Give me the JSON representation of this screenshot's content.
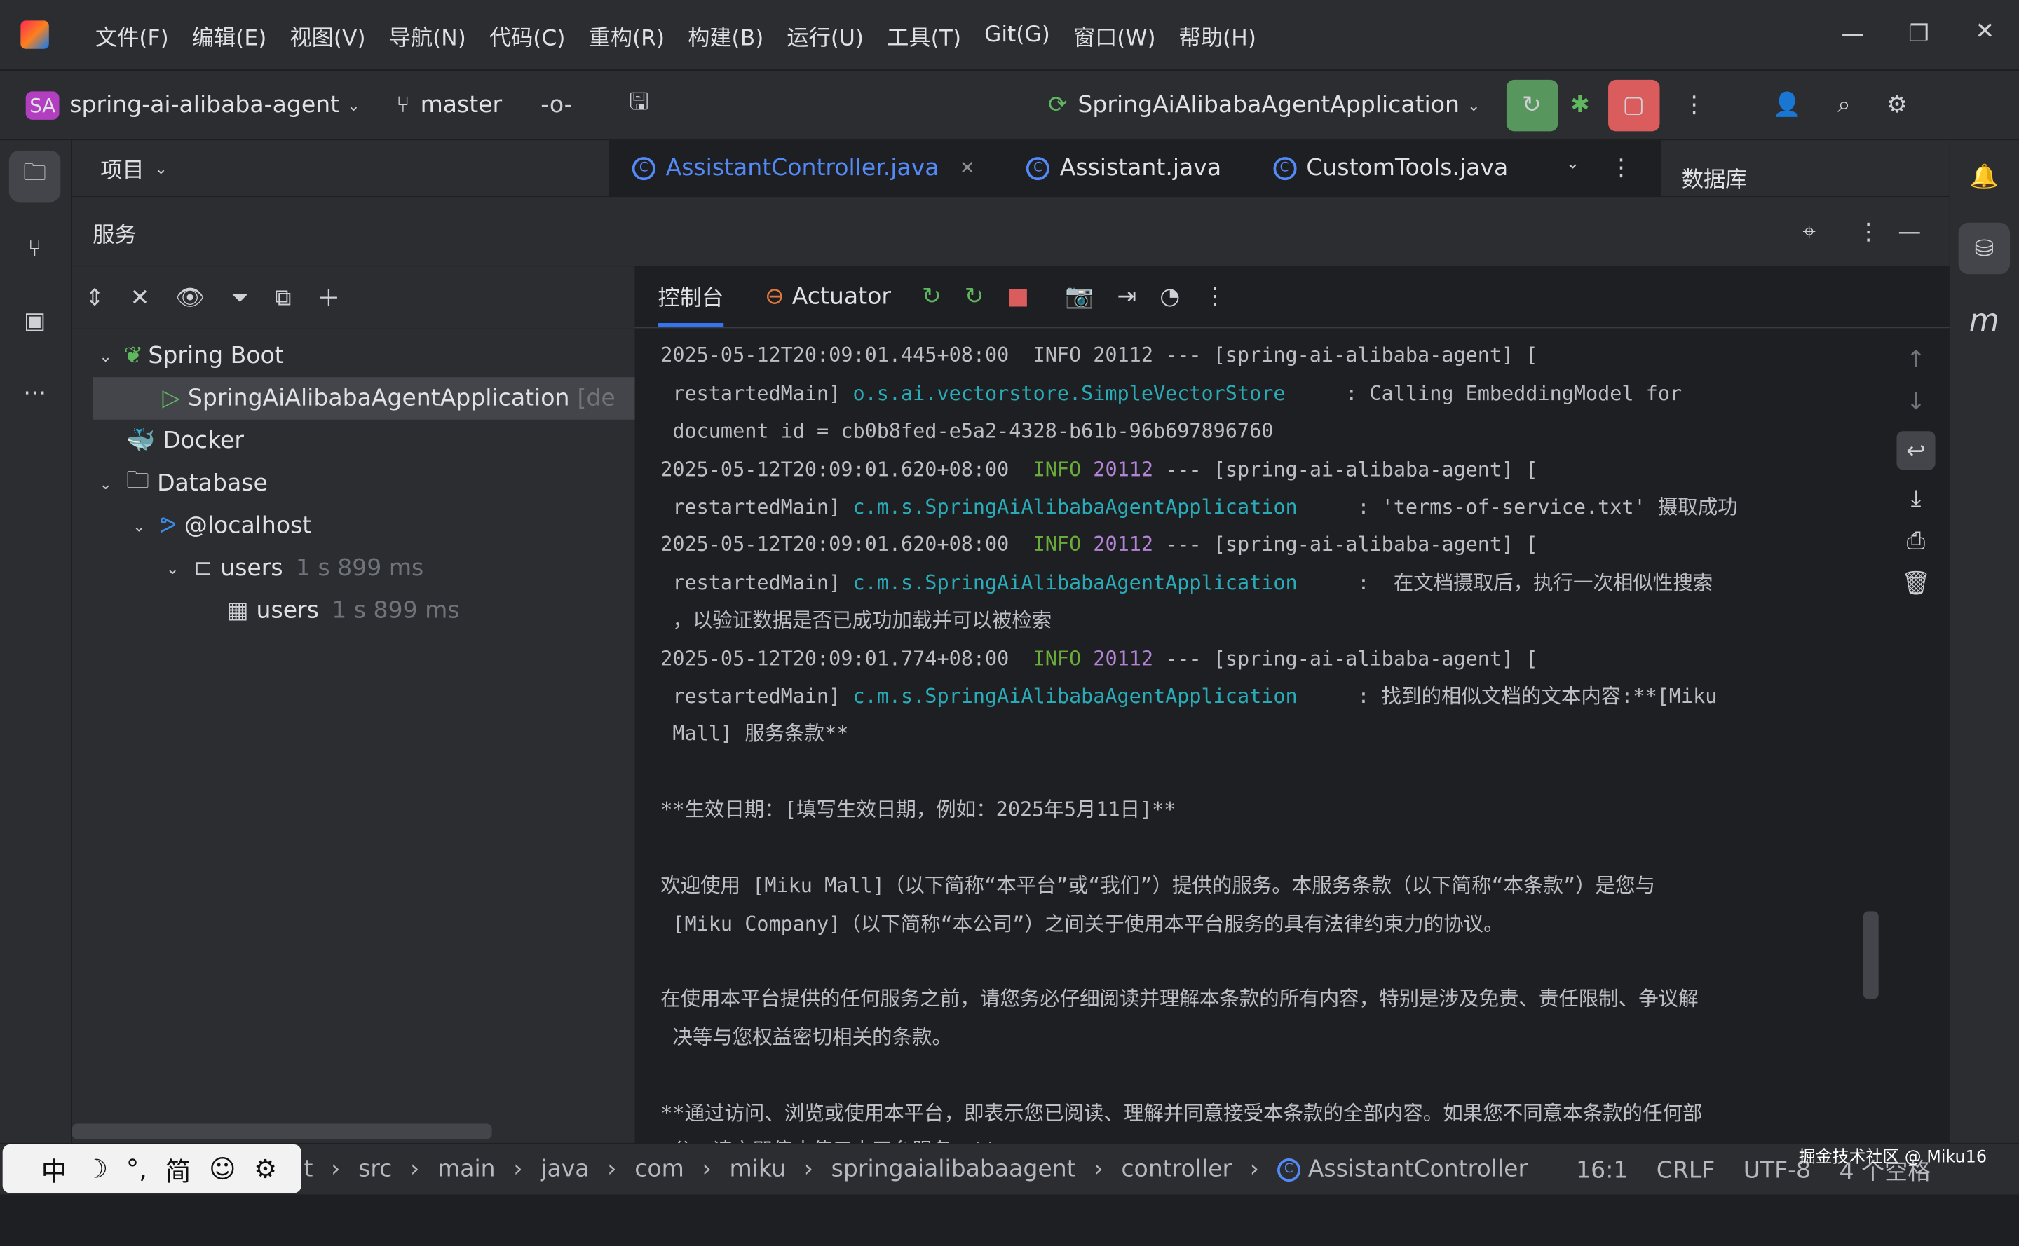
{
  "menu": [
    "文件(F)",
    "编辑(E)",
    "视图(V)",
    "导航(N)",
    "代码(C)",
    "重构(R)",
    "构建(B)",
    "运行(U)",
    "工具(T)",
    "Git(G)",
    "窗口(W)",
    "帮助(H)"
  ],
  "toolbar": {
    "project_badge": "SA",
    "project": "spring-ai-alibaba-agent",
    "branch": "master",
    "run_config": "SpringAiAlibabaAgentApplication"
  },
  "project_panel": {
    "title": "项目"
  },
  "tabs": [
    {
      "label": "AssistantController.java",
      "active": true
    },
    {
      "label": "Assistant.java"
    },
    {
      "label": "CustomTools.java"
    }
  ],
  "database_panel": {
    "title": "数据库"
  },
  "services": {
    "title": "服务",
    "tree": [
      {
        "label": "Spring Boot"
      },
      {
        "label": "SpringAiAlibabaAgentApplication",
        "suffix": "[de"
      },
      {
        "label": "Docker"
      },
      {
        "label": "Database"
      },
      {
        "label": "@localhost"
      },
      {
        "label": "users",
        "time": "1 s 899 ms"
      },
      {
        "label": "users",
        "time": "1 s 899 ms"
      }
    ],
    "console_tabs": [
      "控制台",
      "Actuator"
    ]
  },
  "log": {
    "l0": "2025-05-12T20:09:01.445+08:00  INFO 20112 --- [spring-ai-alibaba-agent] [",
    "l1a": " restartedMain] ",
    "l1b": "o.s.ai.vectorstore.SimpleVectorStore",
    "l1c": "     : Calling EmbeddingModel for",
    "l2": " document id = cb0b8fed-e5a2-4328-b61b-96b697896760",
    "ts2": "2025-05-12T20:09:01.620+08:00",
    "ts3": "2025-05-12T20:09:01.620+08:00",
    "ts4": "2025-05-12T20:09:01.774+08:00",
    "info": "INFO",
    "pid": "20112",
    "thread": " --- [spring-ai-alibaba-agent] [",
    "rm": " restartedMain] ",
    "logger": "c.m.s.SpringAiAlibabaAgentApplication",
    "m2": "     : 'terms-of-service.txt' 摄取成功",
    "m3": "     :  在文档摄取后，执行一次相似性搜索",
    "m3b": " ，以验证数据是否已成功加载并可以被检索",
    "m4": "     : 找到的相似文档的文本内容:**[Miku",
    "m4b": " Mall] 服务条款**",
    "p1": "**生效日期：[填写生效日期，例如：2025年5月11日]**",
    "p2a": "欢迎使用 [Miku Mall]（以下简称“本平台”或“我们”）提供的服务。本服务条款（以下简称“本条款”）是您与",
    "p2b": " [Miku Company]（以下简称“本公司”）之间关于使用本平台服务的具有法律约束力的协议。",
    "p3a": "在使用本平台提供的任何服务之前，请您务必仔细阅读并理解本条款的所有内容，特别是涉及免责、责任限制、争议解",
    "p3b": " 决等与您权益密切相关的条款。",
    "p4a": "**通过访问、浏览或使用本平台，即表示您已阅读、理解并同意接受本条款的全部内容。如果您不同意本条款的任何部",
    "p4b": " 分，请立即停止使用本平台服务。**"
  },
  "ime": [
    "中",
    "☽",
    "°,",
    "简",
    "☺",
    "⚙"
  ],
  "breadcrumb": [
    "t",
    "src",
    "main",
    "java",
    "com",
    "miku",
    "springaialibabaagent",
    "controller",
    "AssistantController"
  ],
  "status": {
    "pos": "16:1",
    "eol": "CRLF",
    "enc": "UTF-8",
    "indent": "4 个空格"
  },
  "watermark": "掘金技术社区 @ Miku16"
}
